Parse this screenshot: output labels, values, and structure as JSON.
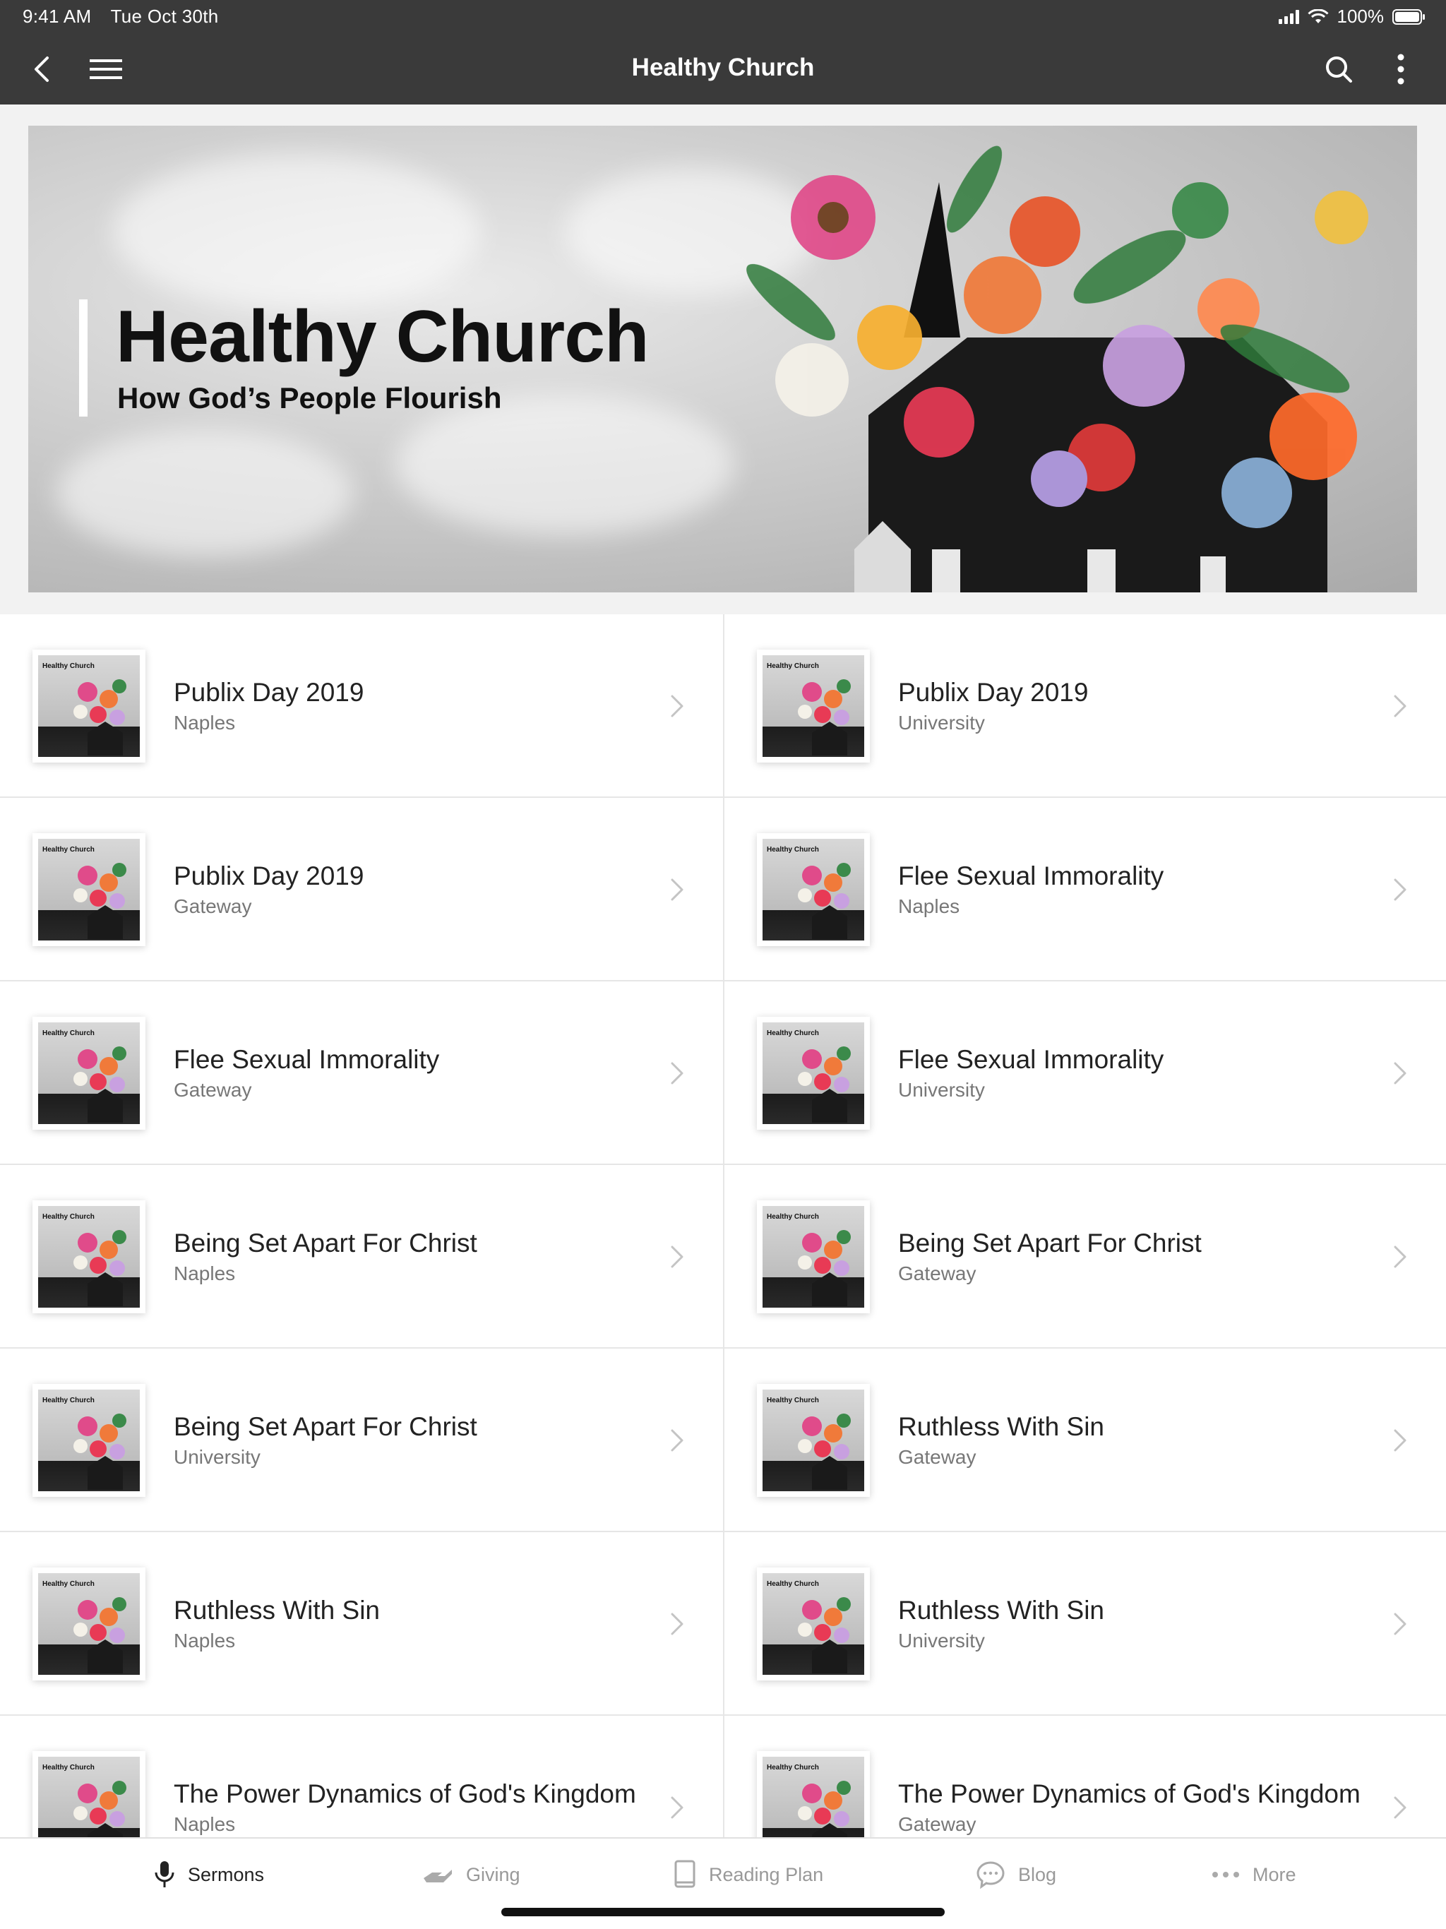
{
  "status_bar": {
    "time": "9:41 AM",
    "date": "Tue Oct 30th",
    "battery": "100%"
  },
  "nav": {
    "title": "Healthy Church",
    "icons": [
      "back-chevron-icon",
      "menu-icon",
      "search-icon",
      "more-vertical-icon"
    ]
  },
  "hero": {
    "title": "Healthy Church",
    "subtitle": "How God’s People Flourish"
  },
  "thumbnail_label": "Healthy Church",
  "items": [
    {
      "title": "Publix Day 2019",
      "location": "Naples"
    },
    {
      "title": "Publix Day 2019",
      "location": "University"
    },
    {
      "title": "Publix Day 2019",
      "location": "Gateway"
    },
    {
      "title": "Flee Sexual Immorality",
      "location": "Naples"
    },
    {
      "title": "Flee Sexual Immorality",
      "location": "Gateway"
    },
    {
      "title": "Flee Sexual Immorality",
      "location": "University"
    },
    {
      "title": "Being Set Apart For Christ",
      "location": "Naples"
    },
    {
      "title": "Being Set Apart For Christ",
      "location": "Gateway"
    },
    {
      "title": "Being Set Apart For Christ",
      "location": "University"
    },
    {
      "title": "Ruthless With Sin",
      "location": "Gateway"
    },
    {
      "title": "Ruthless With Sin",
      "location": "Naples"
    },
    {
      "title": "Ruthless With Sin",
      "location": "University"
    },
    {
      "title": "The Power Dynamics of God's Kingdom",
      "location": "Naples"
    },
    {
      "title": "The Power Dynamics of God's Kingdom",
      "location": "Gateway"
    }
  ],
  "tabs": [
    {
      "label": "Sermons",
      "icon": "microphone-icon",
      "active": true
    },
    {
      "label": "Giving",
      "icon": "giving-hand-icon",
      "active": false
    },
    {
      "label": "Reading Plan",
      "icon": "book-icon",
      "active": false
    },
    {
      "label": "Blog",
      "icon": "chat-bubble-icon",
      "active": false
    },
    {
      "label": "More",
      "icon": "more-dots-icon",
      "active": false
    }
  ]
}
